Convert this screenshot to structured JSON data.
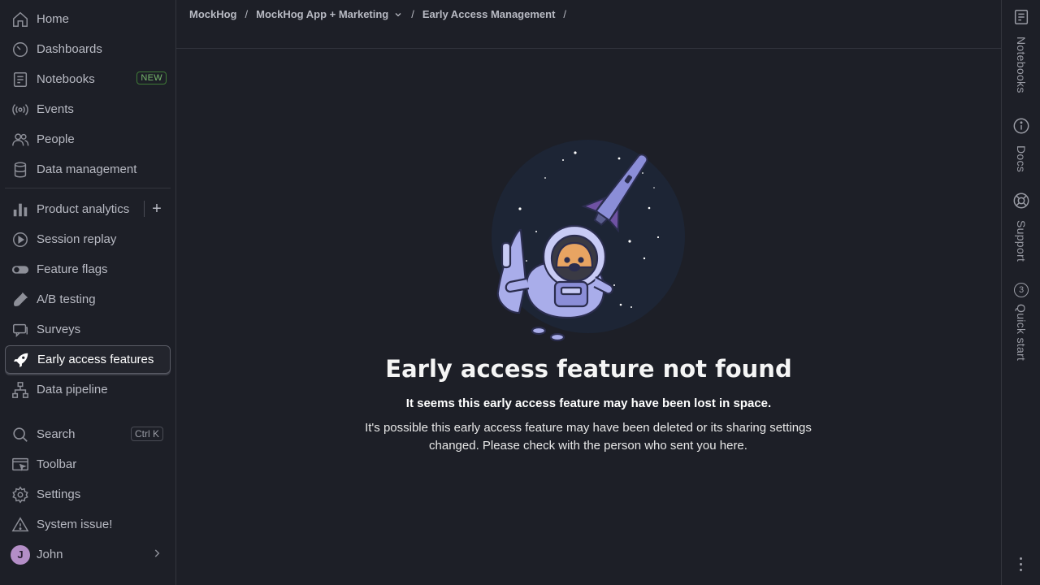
{
  "sidebar": {
    "top_items": [
      {
        "label": "Home",
        "icon": "home-icon"
      },
      {
        "label": "Dashboards",
        "icon": "dashboard-icon"
      },
      {
        "label": "Notebooks",
        "icon": "notebook-icon",
        "badge": "NEW"
      },
      {
        "label": "Events",
        "icon": "broadcast-icon"
      },
      {
        "label": "People",
        "icon": "people-icon"
      },
      {
        "label": "Data management",
        "icon": "database-icon"
      }
    ],
    "product_items": [
      {
        "label": "Product analytics",
        "icon": "bar-chart-icon"
      },
      {
        "label": "Session replay",
        "icon": "replay-icon"
      },
      {
        "label": "Feature flags",
        "icon": "toggle-icon"
      },
      {
        "label": "A/B testing",
        "icon": "flask-icon"
      },
      {
        "label": "Surveys",
        "icon": "chat-icon"
      },
      {
        "label": "Early access features",
        "icon": "rocket-icon",
        "active": true
      },
      {
        "label": "Data pipeline",
        "icon": "pipeline-icon"
      }
    ],
    "bottom_items": [
      {
        "label": "Search",
        "icon": "search-icon",
        "shortcut": "Ctrl K"
      },
      {
        "label": "Toolbar",
        "icon": "toolbar-icon"
      },
      {
        "label": "Settings",
        "icon": "gear-icon"
      },
      {
        "label": "System issue!",
        "icon": "warning-icon"
      }
    ],
    "user": {
      "name": "John",
      "initial": "J",
      "avatar_color": "#b48ec7"
    }
  },
  "breadcrumb": {
    "org": "MockHog",
    "project": "MockHog App + Marketing",
    "page": "Early Access Management",
    "separator": "/"
  },
  "main": {
    "title": "Early access feature not found",
    "subtitle": "It seems this early access feature may have been lost in space.",
    "body": "It's possible this early access feature may have been deleted or its sharing settings changed. Please check with the person who sent you here."
  },
  "rightbar": {
    "items": [
      {
        "label": "Notebooks",
        "icon": "notebook-icon"
      },
      {
        "label": "Docs",
        "icon": "info-icon"
      },
      {
        "label": "Support",
        "icon": "lifebuoy-icon"
      },
      {
        "label": "Quick start",
        "icon": "progress-icon",
        "count": "3"
      }
    ]
  },
  "colors": {
    "background": "#1d1f27",
    "border": "#32343d",
    "new_badge": "#77b96c",
    "text_muted": "#b8bac3"
  }
}
